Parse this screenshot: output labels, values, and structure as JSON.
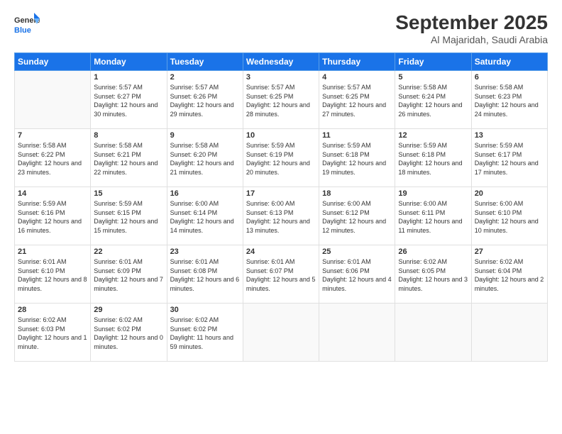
{
  "logo": {
    "line1": "General",
    "line2": "Blue"
  },
  "header": {
    "month": "September 2025",
    "location": "Al Majaridah, Saudi Arabia"
  },
  "weekdays": [
    "Sunday",
    "Monday",
    "Tuesday",
    "Wednesday",
    "Thursday",
    "Friday",
    "Saturday"
  ],
  "weeks": [
    [
      {
        "day": "",
        "sunrise": "",
        "sunset": "",
        "daylight": ""
      },
      {
        "day": "1",
        "sunrise": "Sunrise: 5:57 AM",
        "sunset": "Sunset: 6:27 PM",
        "daylight": "Daylight: 12 hours and 30 minutes."
      },
      {
        "day": "2",
        "sunrise": "Sunrise: 5:57 AM",
        "sunset": "Sunset: 6:26 PM",
        "daylight": "Daylight: 12 hours and 29 minutes."
      },
      {
        "day": "3",
        "sunrise": "Sunrise: 5:57 AM",
        "sunset": "Sunset: 6:25 PM",
        "daylight": "Daylight: 12 hours and 28 minutes."
      },
      {
        "day": "4",
        "sunrise": "Sunrise: 5:57 AM",
        "sunset": "Sunset: 6:25 PM",
        "daylight": "Daylight: 12 hours and 27 minutes."
      },
      {
        "day": "5",
        "sunrise": "Sunrise: 5:58 AM",
        "sunset": "Sunset: 6:24 PM",
        "daylight": "Daylight: 12 hours and 26 minutes."
      },
      {
        "day": "6",
        "sunrise": "Sunrise: 5:58 AM",
        "sunset": "Sunset: 6:23 PM",
        "daylight": "Daylight: 12 hours and 24 minutes."
      }
    ],
    [
      {
        "day": "7",
        "sunrise": "Sunrise: 5:58 AM",
        "sunset": "Sunset: 6:22 PM",
        "daylight": "Daylight: 12 hours and 23 minutes."
      },
      {
        "day": "8",
        "sunrise": "Sunrise: 5:58 AM",
        "sunset": "Sunset: 6:21 PM",
        "daylight": "Daylight: 12 hours and 22 minutes."
      },
      {
        "day": "9",
        "sunrise": "Sunrise: 5:58 AM",
        "sunset": "Sunset: 6:20 PM",
        "daylight": "Daylight: 12 hours and 21 minutes."
      },
      {
        "day": "10",
        "sunrise": "Sunrise: 5:59 AM",
        "sunset": "Sunset: 6:19 PM",
        "daylight": "Daylight: 12 hours and 20 minutes."
      },
      {
        "day": "11",
        "sunrise": "Sunrise: 5:59 AM",
        "sunset": "Sunset: 6:18 PM",
        "daylight": "Daylight: 12 hours and 19 minutes."
      },
      {
        "day": "12",
        "sunrise": "Sunrise: 5:59 AM",
        "sunset": "Sunset: 6:18 PM",
        "daylight": "Daylight: 12 hours and 18 minutes."
      },
      {
        "day": "13",
        "sunrise": "Sunrise: 5:59 AM",
        "sunset": "Sunset: 6:17 PM",
        "daylight": "Daylight: 12 hours and 17 minutes."
      }
    ],
    [
      {
        "day": "14",
        "sunrise": "Sunrise: 5:59 AM",
        "sunset": "Sunset: 6:16 PM",
        "daylight": "Daylight: 12 hours and 16 minutes."
      },
      {
        "day": "15",
        "sunrise": "Sunrise: 5:59 AM",
        "sunset": "Sunset: 6:15 PM",
        "daylight": "Daylight: 12 hours and 15 minutes."
      },
      {
        "day": "16",
        "sunrise": "Sunrise: 6:00 AM",
        "sunset": "Sunset: 6:14 PM",
        "daylight": "Daylight: 12 hours and 14 minutes."
      },
      {
        "day": "17",
        "sunrise": "Sunrise: 6:00 AM",
        "sunset": "Sunset: 6:13 PM",
        "daylight": "Daylight: 12 hours and 13 minutes."
      },
      {
        "day": "18",
        "sunrise": "Sunrise: 6:00 AM",
        "sunset": "Sunset: 6:12 PM",
        "daylight": "Daylight: 12 hours and 12 minutes."
      },
      {
        "day": "19",
        "sunrise": "Sunrise: 6:00 AM",
        "sunset": "Sunset: 6:11 PM",
        "daylight": "Daylight: 12 hours and 11 minutes."
      },
      {
        "day": "20",
        "sunrise": "Sunrise: 6:00 AM",
        "sunset": "Sunset: 6:10 PM",
        "daylight": "Daylight: 12 hours and 10 minutes."
      }
    ],
    [
      {
        "day": "21",
        "sunrise": "Sunrise: 6:01 AM",
        "sunset": "Sunset: 6:10 PM",
        "daylight": "Daylight: 12 hours and 8 minutes."
      },
      {
        "day": "22",
        "sunrise": "Sunrise: 6:01 AM",
        "sunset": "Sunset: 6:09 PM",
        "daylight": "Daylight: 12 hours and 7 minutes."
      },
      {
        "day": "23",
        "sunrise": "Sunrise: 6:01 AM",
        "sunset": "Sunset: 6:08 PM",
        "daylight": "Daylight: 12 hours and 6 minutes."
      },
      {
        "day": "24",
        "sunrise": "Sunrise: 6:01 AM",
        "sunset": "Sunset: 6:07 PM",
        "daylight": "Daylight: 12 hours and 5 minutes."
      },
      {
        "day": "25",
        "sunrise": "Sunrise: 6:01 AM",
        "sunset": "Sunset: 6:06 PM",
        "daylight": "Daylight: 12 hours and 4 minutes."
      },
      {
        "day": "26",
        "sunrise": "Sunrise: 6:02 AM",
        "sunset": "Sunset: 6:05 PM",
        "daylight": "Daylight: 12 hours and 3 minutes."
      },
      {
        "day": "27",
        "sunrise": "Sunrise: 6:02 AM",
        "sunset": "Sunset: 6:04 PM",
        "daylight": "Daylight: 12 hours and 2 minutes."
      }
    ],
    [
      {
        "day": "28",
        "sunrise": "Sunrise: 6:02 AM",
        "sunset": "Sunset: 6:03 PM",
        "daylight": "Daylight: 12 hours and 1 minute."
      },
      {
        "day": "29",
        "sunrise": "Sunrise: 6:02 AM",
        "sunset": "Sunset: 6:02 PM",
        "daylight": "Daylight: 12 hours and 0 minutes."
      },
      {
        "day": "30",
        "sunrise": "Sunrise: 6:02 AM",
        "sunset": "Sunset: 6:02 PM",
        "daylight": "Daylight: 11 hours and 59 minutes."
      },
      {
        "day": "",
        "sunrise": "",
        "sunset": "",
        "daylight": ""
      },
      {
        "day": "",
        "sunrise": "",
        "sunset": "",
        "daylight": ""
      },
      {
        "day": "",
        "sunrise": "",
        "sunset": "",
        "daylight": ""
      },
      {
        "day": "",
        "sunrise": "",
        "sunset": "",
        "daylight": ""
      }
    ]
  ]
}
